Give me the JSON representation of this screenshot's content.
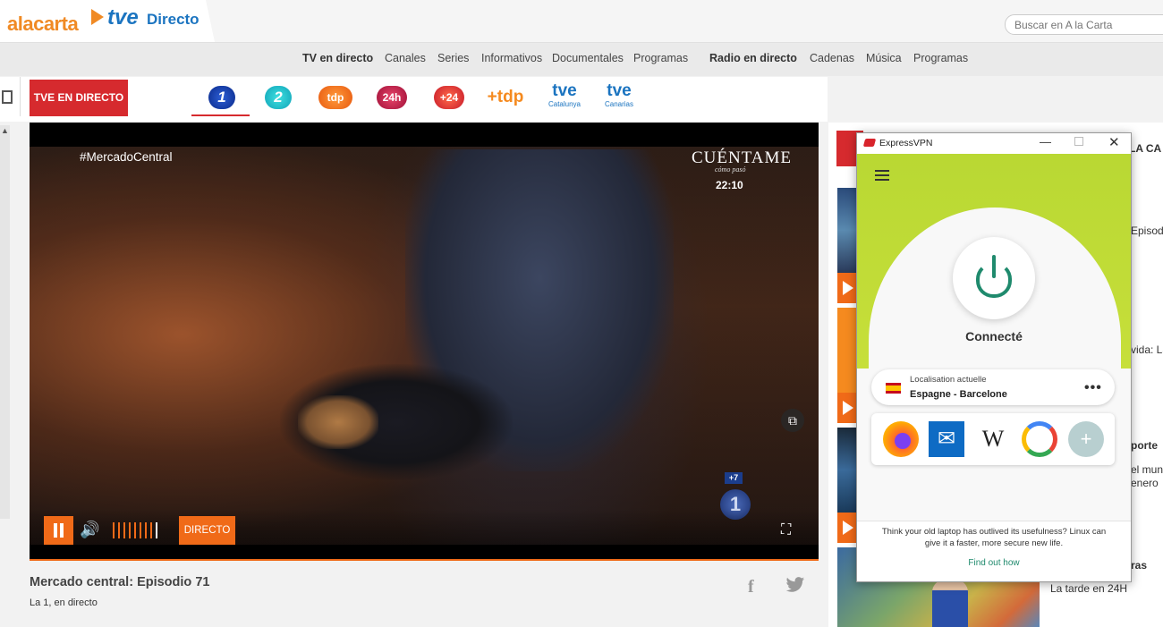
{
  "header": {
    "logo_alacarta": "alacarta",
    "logo_tve": "tve",
    "logo_directo": "Directo",
    "search_placeholder": "Buscar en A la Carta"
  },
  "nav": {
    "tv_group": [
      "TV en directo",
      "Canales",
      "Series",
      "Informativos",
      "Documentales",
      "Programas"
    ],
    "radio_group": [
      "Radio en directo",
      "Cadenas",
      "Música",
      "Programas"
    ]
  },
  "channels": {
    "live_button": "TVE EN DIRECTO",
    "items": [
      "1",
      "2",
      "tdp",
      "24h",
      "+24",
      "+tdp",
      "tve",
      "Catalunya",
      "tve",
      "Canarias"
    ],
    "active": "1"
  },
  "player": {
    "hashtag": "#MercadoCentral",
    "show_logo": "CUÉNTAME",
    "show_logo_sub": "cómo pasó",
    "clock": "22:10",
    "badge_plus": "+7",
    "badge_channel": "1",
    "live_button": "DIRECTO"
  },
  "video": {
    "title": "Mercado central: Episodio 71",
    "subtitle": "La 1, en directo"
  },
  "right_column": {
    "heading": "LA CA",
    "texts": [
      "Episod",
      "vida: La",
      "porte",
      "el mun",
      "enero",
      "ras",
      "La tarde en 24H"
    ]
  },
  "vpn": {
    "app_title": "ExpressVPN",
    "minimize": "—",
    "close": "✕",
    "status": "Connecté",
    "location_label": "Localisation actuelle",
    "location_value": "Espagne - Barcelone",
    "more": "•••",
    "shortcuts": [
      "firefox",
      "mail",
      "W",
      "google",
      "+"
    ],
    "promo": "Think your old laptop has outlived its usefulness? Linux can give it a faster, more secure new life.",
    "link": "Find out how"
  },
  "colors": {
    "brand_red": "#d62a2e",
    "player_orange": "#f06a18",
    "tve_blue": "#1b74c0",
    "vpn_green": "#1f8a6d",
    "vpn_lime": "#c7df3a"
  }
}
